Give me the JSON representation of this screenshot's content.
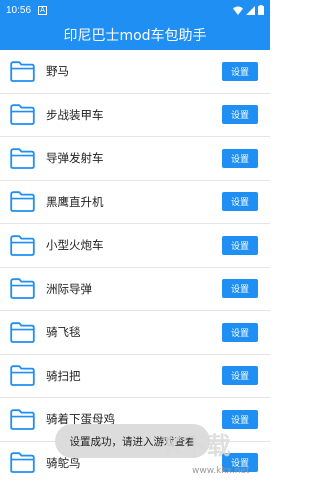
{
  "status_bar": {
    "time": "10:56",
    "notif": "A"
  },
  "app_bar": {
    "title": "印尼巴士mod车包助手"
  },
  "items": [
    {
      "label": "野马",
      "button": "设置"
    },
    {
      "label": "步战装甲车",
      "button": "设置"
    },
    {
      "label": "导弹发射车",
      "button": "设置"
    },
    {
      "label": "黑鹰直升机",
      "button": "设置"
    },
    {
      "label": "小型火炮车",
      "button": "设置"
    },
    {
      "label": "洲际导弹",
      "button": "设置"
    },
    {
      "label": "骑飞毯",
      "button": "设置"
    },
    {
      "label": "骑扫把",
      "button": "设置"
    },
    {
      "label": "骑着下蛋母鸡",
      "button": "设置"
    },
    {
      "label": "骑鸵鸟",
      "button": "设置"
    }
  ],
  "toast": {
    "text": "设置成功，请进入游戏查看"
  },
  "watermark": {
    "text": "www.kkx.net"
  },
  "colors": {
    "primary": "#1f8ff3",
    "folder": "#1f8ff3"
  }
}
